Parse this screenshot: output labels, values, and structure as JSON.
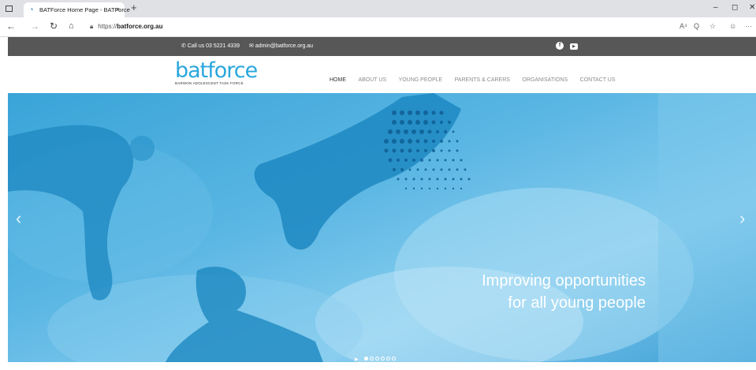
{
  "browser": {
    "tab_title": "BATForce Home Page - BATForce",
    "tab_close": "×",
    "new_tab": "+",
    "url_prefix": "https://",
    "url_host": "batforce.org.au",
    "win_min": "–",
    "win_max": "◻",
    "win_close": "✕",
    "right_icons": [
      "A⁴",
      "Q",
      "☆",
      "☺",
      "···"
    ]
  },
  "topbar": {
    "phone": "Call us 03 5221 4339",
    "email": "admin@batforce.org.au"
  },
  "header": {
    "logo_word": "batforce",
    "logo_tagline": "BARWON ADOLESCENT TASK FORCE",
    "menu": [
      "HOME",
      "ABOUT US",
      "YOUNG PEOPLE",
      "PARENTS & CARERS",
      "ORGANISATIONS",
      "CONTACT US"
    ]
  },
  "hero": {
    "line1": "Improving opportunities",
    "line2": "for all young people",
    "slide_count": 6,
    "active_slide": 1
  },
  "colors": {
    "brand_blue": "#2aa7de",
    "topbar_gray": "#575757"
  }
}
